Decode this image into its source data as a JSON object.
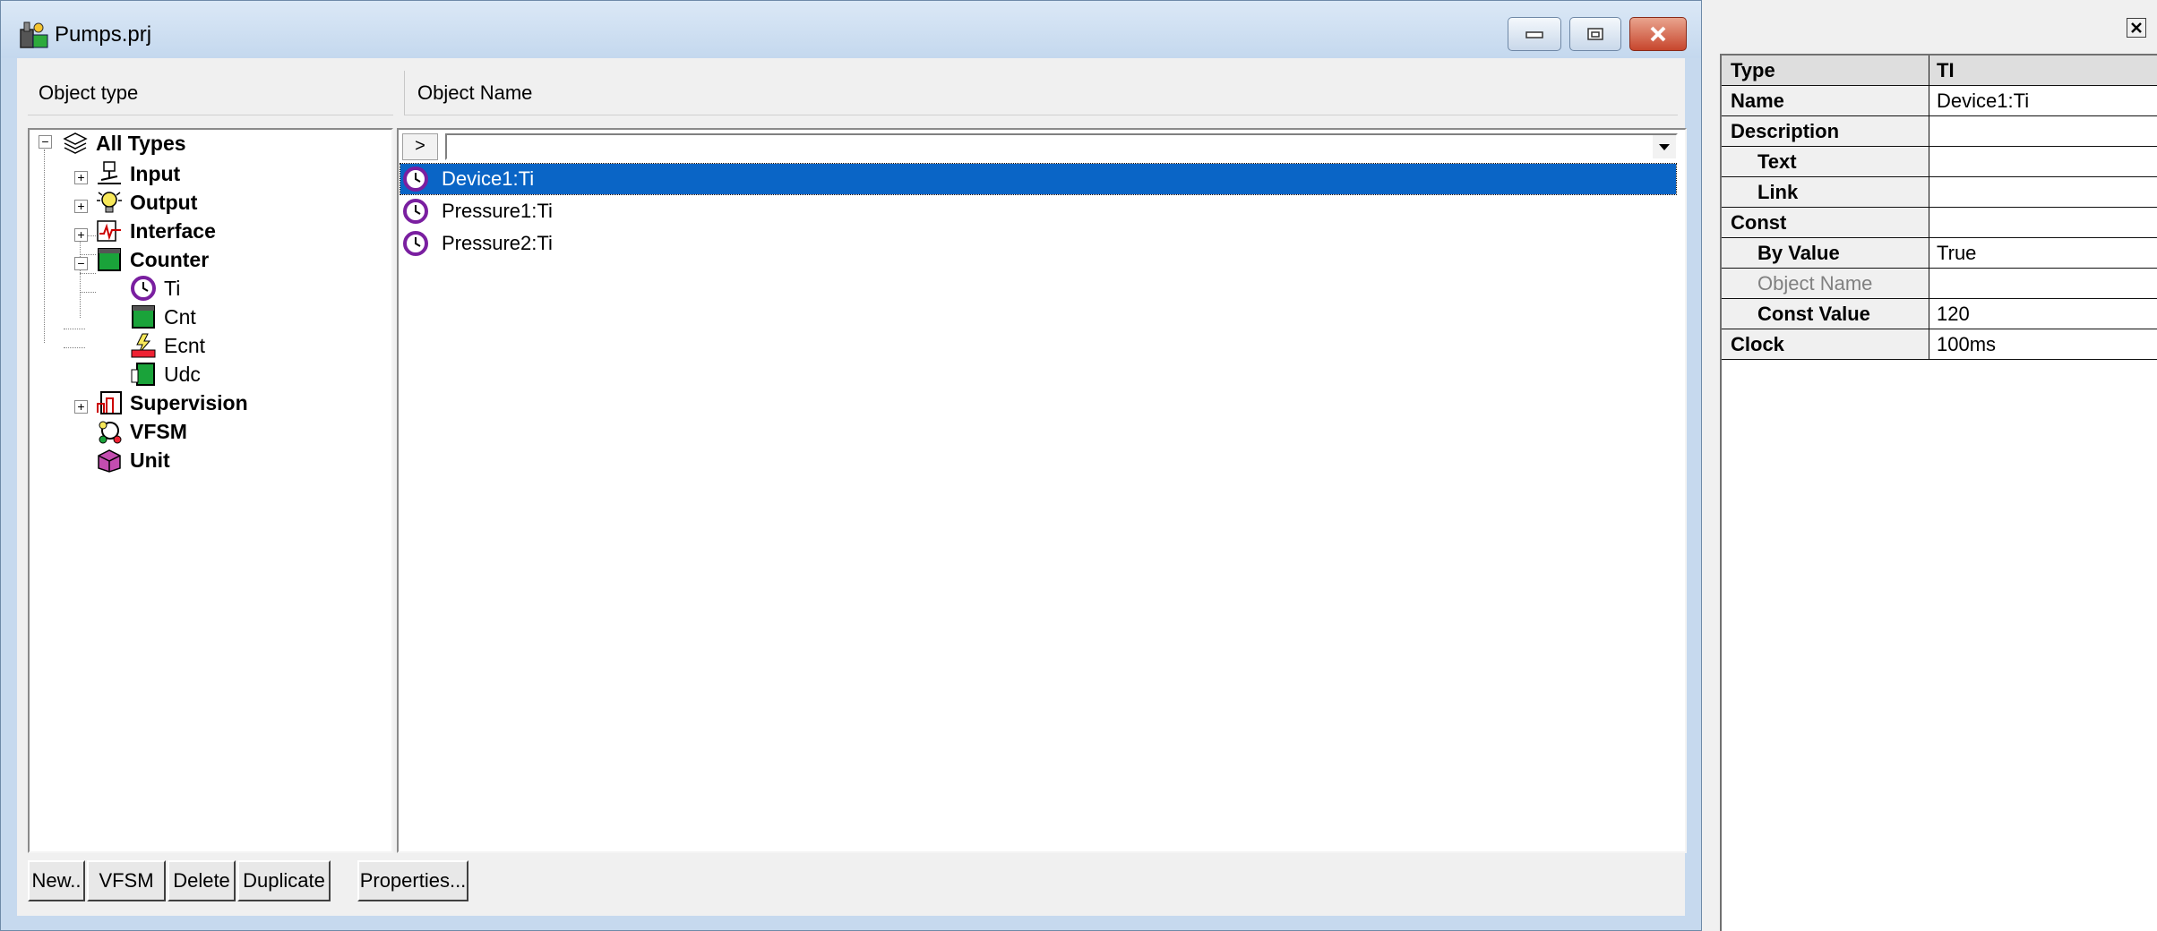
{
  "window": {
    "title": "Pumps.prj"
  },
  "panes": {
    "object_type_header": "Object type",
    "object_name_header": "Object Name"
  },
  "tree": {
    "root": "All Types",
    "nodes": [
      "Input",
      "Output",
      "Interface",
      "Counter",
      "Supervision",
      "VFSM",
      "Unit"
    ],
    "counter_children": [
      "Ti",
      "Cnt",
      "Ecnt",
      "Udc"
    ]
  },
  "list": {
    "filter_button": ">",
    "filter_value": "",
    "items": [
      {
        "name": "Device1:Ti",
        "selected": true
      },
      {
        "name": "Pressure1:Ti",
        "selected": false
      },
      {
        "name": "Pressure2:Ti",
        "selected": false
      }
    ]
  },
  "buttons": {
    "new": "New..",
    "vfsm": "VFSM",
    "delete": "Delete",
    "duplicate": "Duplicate",
    "properties": "Properties..."
  },
  "properties": {
    "rows": [
      {
        "key": "Type",
        "value": "TI"
      },
      {
        "key": "Name",
        "value": "Device1:Ti"
      },
      {
        "key": "Description",
        "value": ""
      },
      {
        "key": "Text",
        "value": ""
      },
      {
        "key": "Link",
        "value": ""
      },
      {
        "key": "Const",
        "value": ""
      },
      {
        "key": "By Value",
        "value": "True"
      },
      {
        "key": "Object Name",
        "value": ""
      },
      {
        "key": "Const Value",
        "value": "120"
      },
      {
        "key": "Clock",
        "value": "100ms"
      }
    ]
  },
  "colors": {
    "selection": "#0a65c6",
    "titlebar": "#c4d8ee",
    "close_button": "#c7462d",
    "timer_icon": "#7a1fa0",
    "counter_icon": "#1aa33a"
  },
  "icons": {
    "app": "project-icon",
    "all_types": "layers-icon",
    "input": "switch-icon",
    "output": "lightbulb-icon",
    "interface": "signal-icon",
    "counter": "counter-icon",
    "timer": "clock-icon",
    "ecnt": "event-counter-icon",
    "udc": "up-down-counter-icon",
    "supervision": "supervision-icon",
    "vfsm": "state-machine-icon",
    "unit": "unit-icon"
  }
}
